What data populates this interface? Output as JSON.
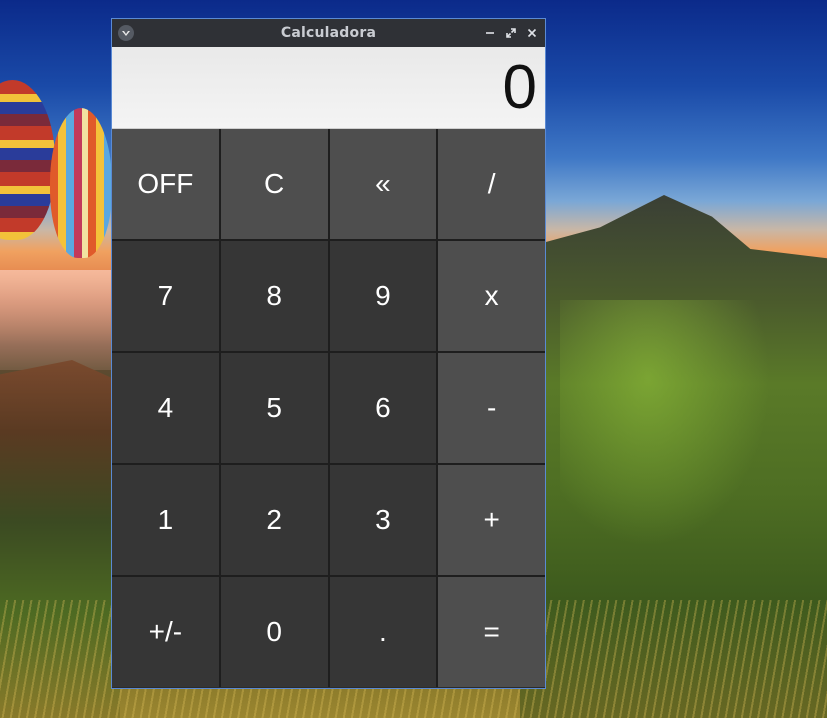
{
  "window": {
    "title": "Calculadora"
  },
  "display": {
    "value": "0"
  },
  "keys": [
    {
      "label": "OFF",
      "kind": "fn"
    },
    {
      "label": "C",
      "kind": "fn"
    },
    {
      "label": "«",
      "kind": "fn"
    },
    {
      "label": "/",
      "kind": "op"
    },
    {
      "label": "7",
      "kind": "num"
    },
    {
      "label": "8",
      "kind": "num"
    },
    {
      "label": "9",
      "kind": "num"
    },
    {
      "label": "x",
      "kind": "op"
    },
    {
      "label": "4",
      "kind": "num"
    },
    {
      "label": "5",
      "kind": "num"
    },
    {
      "label": "6",
      "kind": "num"
    },
    {
      "label": "-",
      "kind": "op"
    },
    {
      "label": "1",
      "kind": "num"
    },
    {
      "label": "2",
      "kind": "num"
    },
    {
      "label": "3",
      "kind": "num"
    },
    {
      "label": "+",
      "kind": "op"
    },
    {
      "label": "+/-",
      "kind": "num"
    },
    {
      "label": "0",
      "kind": "num"
    },
    {
      "label": ".",
      "kind": "num"
    },
    {
      "label": "=",
      "kind": "op"
    }
  ],
  "colors": {
    "titlebar": "#2f3136",
    "fn_key": "#4e4e4e",
    "num_key": "#363636",
    "op_key": "#4e4e4e",
    "display_bg": "#eeeeee",
    "window_border": "#5a8ad4"
  },
  "icons": {
    "app": "calculator-app-icon",
    "minimize": "minimize-icon",
    "maximize": "maximize-icon",
    "close": "close-icon"
  }
}
